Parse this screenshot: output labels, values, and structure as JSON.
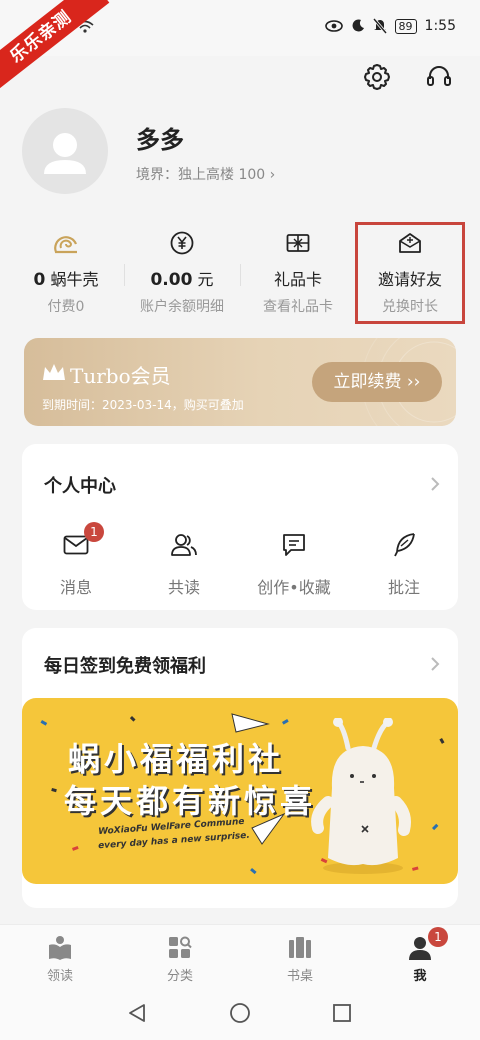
{
  "watermark": "乐乐亲测",
  "status_bar": {
    "battery": "89",
    "time": "1:55"
  },
  "profile": {
    "name": "多多",
    "realm": "境界：独上高楼 100 ›"
  },
  "stats": [
    {
      "value": "0",
      "unit": "蜗牛壳",
      "sub": "付费0",
      "icon": "snail-shell-icon"
    },
    {
      "value": "0.00",
      "unit": "元",
      "sub": "账户余额明细",
      "icon": "yen-coin-icon"
    },
    {
      "value": "",
      "unit": "礼品卡",
      "sub": "查看礼品卡",
      "icon": "gift-card-icon"
    },
    {
      "value": "",
      "unit": "邀请好友",
      "sub": "兑换时长",
      "icon": "invite-envelope-icon"
    }
  ],
  "turbo": {
    "title": "Turbo会员",
    "expire": "到期时间：2023-03-14，购买可叠加",
    "button": "立即续费 ››"
  },
  "personal_center": {
    "title": "个人中心",
    "items": [
      {
        "label": "消息",
        "icon": "mail-icon",
        "badge": "1"
      },
      {
        "label": "共读",
        "icon": "people-icon"
      },
      {
        "label": "创作•收藏",
        "icon": "chat-note-icon"
      },
      {
        "label": "批注",
        "icon": "feather-icon"
      }
    ]
  },
  "signin": {
    "title": "每日签到免费领福利",
    "banner_line1": "蜗小福福利社",
    "banner_line2": "每天都有新惊喜",
    "banner_en1": "WoXiaoFu WelFare Commune",
    "banner_en2": "every day has a new surprise."
  },
  "tabs": [
    {
      "label": "领读",
      "icon": "book-reader-icon"
    },
    {
      "label": "分类",
      "icon": "category-icon"
    },
    {
      "label": "书桌",
      "icon": "bookshelf-icon"
    },
    {
      "label": "我",
      "icon": "user-icon",
      "badge": "1",
      "active": true
    }
  ],
  "colors": {
    "accent_red": "#c9473d",
    "turbo_gold": "#c5a47c",
    "banner_yellow": "#f5c63a"
  }
}
